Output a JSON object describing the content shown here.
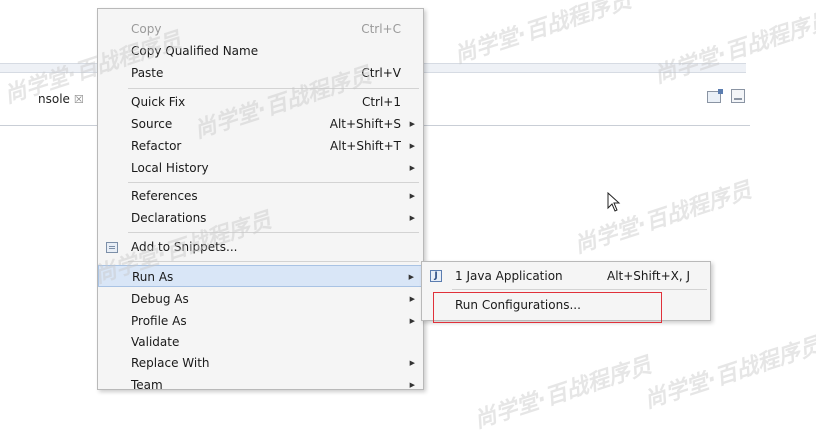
{
  "console_tab": {
    "label": "nsole",
    "close_glyph": "☒"
  },
  "menu": {
    "items": [
      {
        "label": "Copy",
        "accel": "Ctrl+C",
        "disabled": true
      },
      {
        "label": "Copy Qualified Name",
        "accel": ""
      },
      {
        "label": "Paste",
        "accel": "Ctrl+V"
      },
      {
        "label": "Quick Fix",
        "accel": "Ctrl+1"
      },
      {
        "label": "Source",
        "accel": "Alt+Shift+S"
      },
      {
        "label": "Refactor",
        "accel": "Alt+Shift+T"
      },
      {
        "label": "Local History",
        "accel": ""
      },
      {
        "label": "References",
        "accel": ""
      },
      {
        "label": "Declarations",
        "accel": ""
      },
      {
        "label": "Add to Snippets...",
        "accel": "",
        "icon": "snippet-icon"
      },
      {
        "label": "Run As",
        "accel": "",
        "highlighted": true
      },
      {
        "label": "Debug As",
        "accel": ""
      },
      {
        "label": "Profile As",
        "accel": ""
      },
      {
        "label": "Validate",
        "accel": ""
      },
      {
        "label": "Replace With",
        "accel": ""
      },
      {
        "label": "Team",
        "accel": ""
      }
    ],
    "submenu_arrow": "▶"
  },
  "run_as_submenu": {
    "items": [
      {
        "label": "1 Java Application",
        "accel": "Alt+Shift+X, J",
        "icon": "java-app-icon",
        "icon_glyph": "J"
      },
      {
        "label": "Run Configurations...",
        "accel": ""
      }
    ]
  },
  "watermark": {
    "text": "尚学堂·百战程序员"
  },
  "colors": {
    "highlight_bg": "#d9e6f7",
    "red_box": "#e0313a",
    "menu_bg": "#f5f5f5"
  }
}
